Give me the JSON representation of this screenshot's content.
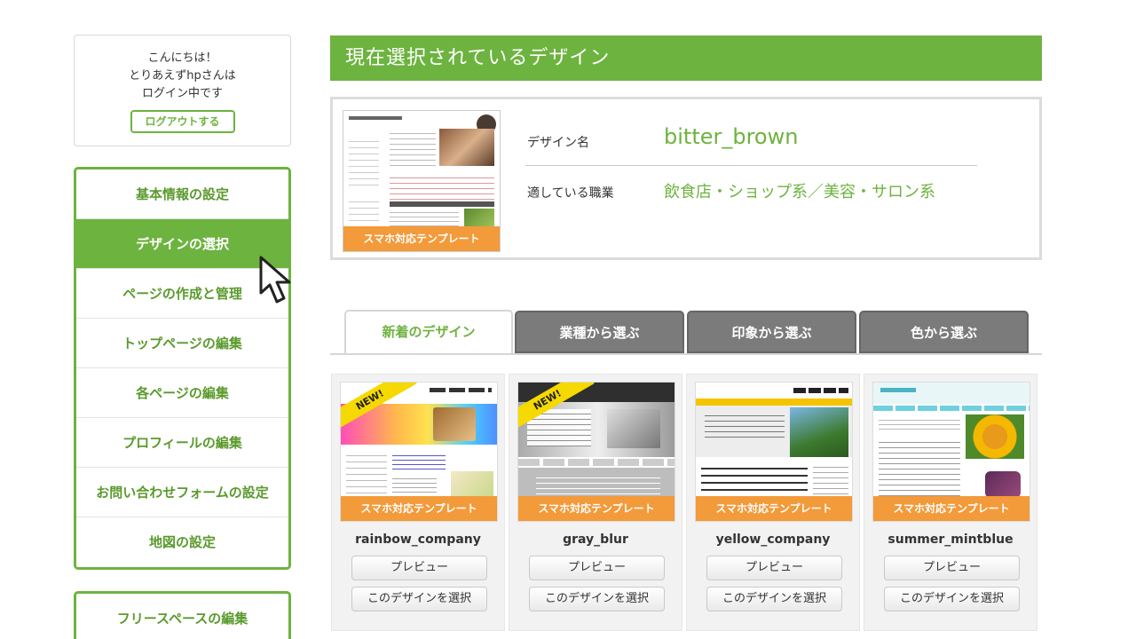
{
  "sidebar": {
    "greeting": [
      "こんにちは！",
      "とりあえずhpさんは",
      "ログイン中です"
    ],
    "logout_label": "ログアウトする",
    "menu": [
      {
        "label": "基本情報の設定",
        "active": false
      },
      {
        "label": "デザインの選択",
        "active": true
      },
      {
        "label": "ページの作成と管理",
        "active": false
      },
      {
        "label": "トップページの編集",
        "active": false
      },
      {
        "label": "各ページの編集",
        "active": false
      },
      {
        "label": "プロフィールの編集",
        "active": false
      },
      {
        "label": "お問い合わせフォームの設定",
        "active": false
      },
      {
        "label": "地図の設定",
        "active": false
      }
    ],
    "menu2": [
      {
        "label": "フリースペースの編集"
      }
    ]
  },
  "current": {
    "header": "現在選択されているデザイン",
    "thumb_banner": "スマホ対応テンプレート",
    "design_name_label": "デザイン名",
    "design_name": "bitter_brown",
    "job_label": "適している職業",
    "job_value": "飲食店・ショップ系／美容・サロン系"
  },
  "tabs": [
    {
      "label": "新着のデザイン",
      "active": true
    },
    {
      "label": "業種から選ぶ",
      "active": false
    },
    {
      "label": "印象から選ぶ",
      "active": false
    },
    {
      "label": "色から選ぶ",
      "active": false
    }
  ],
  "designs": [
    {
      "name": "rainbow_company",
      "new": true,
      "banner": "スマホ対応テンプレート",
      "new_label": "NEW!",
      "preview_label": "プレビュー",
      "select_label": "このデザインを選択"
    },
    {
      "name": "gray_blur",
      "new": true,
      "banner": "スマホ対応テンプレート",
      "new_label": "NEW!",
      "preview_label": "プレビュー",
      "select_label": "このデザインを選択"
    },
    {
      "name": "yellow_company",
      "new": false,
      "banner": "スマホ対応テンプレート",
      "preview_label": "プレビュー",
      "select_label": "このデザインを選択"
    },
    {
      "name": "summer_mintblue",
      "new": false,
      "banner": "スマホ対応テンプレート",
      "preview_label": "プレビュー",
      "select_label": "このデザインを選択"
    }
  ],
  "colors": {
    "accent": "#6db33f",
    "banner": "#f39a3a",
    "new_badge": "#f5d900",
    "tab_inactive": "#7b7b7b"
  }
}
